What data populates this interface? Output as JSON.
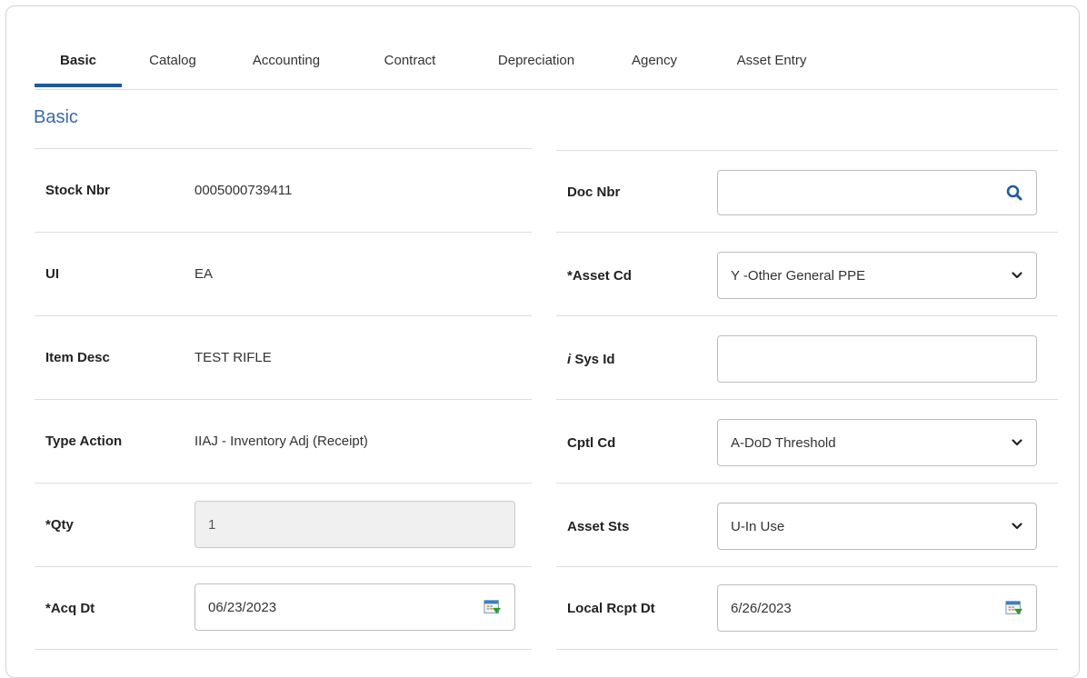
{
  "tabs": [
    {
      "label": "Basic",
      "active": true
    },
    {
      "label": "Catalog",
      "active": false
    },
    {
      "label": "Accounting",
      "active": false
    },
    {
      "label": "Contract",
      "active": false
    },
    {
      "label": "Depreciation",
      "active": false
    },
    {
      "label": "Agency",
      "active": false
    },
    {
      "label": "Asset Entry",
      "active": false
    }
  ],
  "section_title": "Basic",
  "left": {
    "stock_nbr": {
      "label": "Stock Nbr",
      "value": "0005000739411"
    },
    "ui": {
      "label": "UI",
      "value": "EA"
    },
    "item_desc": {
      "label": "Item Desc",
      "value": "TEST RIFLE"
    },
    "type_action": {
      "label": "Type Action",
      "value": "IIAJ - Inventory Adj (Receipt)"
    },
    "qty": {
      "label": "*Qty",
      "value": "1"
    },
    "acq_dt": {
      "label": "*Acq Dt",
      "value": "06/23/2023"
    }
  },
  "right": {
    "doc_nbr": {
      "label": "Doc Nbr",
      "value": ""
    },
    "asset_cd": {
      "label": "*Asset Cd",
      "value": "Y -Other General PPE"
    },
    "sys_id": {
      "label_prefix": "i",
      "label": " Sys Id",
      "value": ""
    },
    "cptl_cd": {
      "label": "Cptl Cd",
      "value": "A-DoD Threshold"
    },
    "asset_sts": {
      "label": "Asset Sts",
      "value": "U-In Use"
    },
    "local_rcpt_dt": {
      "label": "Local Rcpt Dt",
      "value": "6/26/2023"
    }
  },
  "colors": {
    "accent": "#1f5a9e",
    "section_title": "#3a6aa8",
    "search_icon": "#1f5a9e"
  },
  "icons": [
    "search-icon",
    "chevron-down-icon",
    "calendar-icon"
  ]
}
